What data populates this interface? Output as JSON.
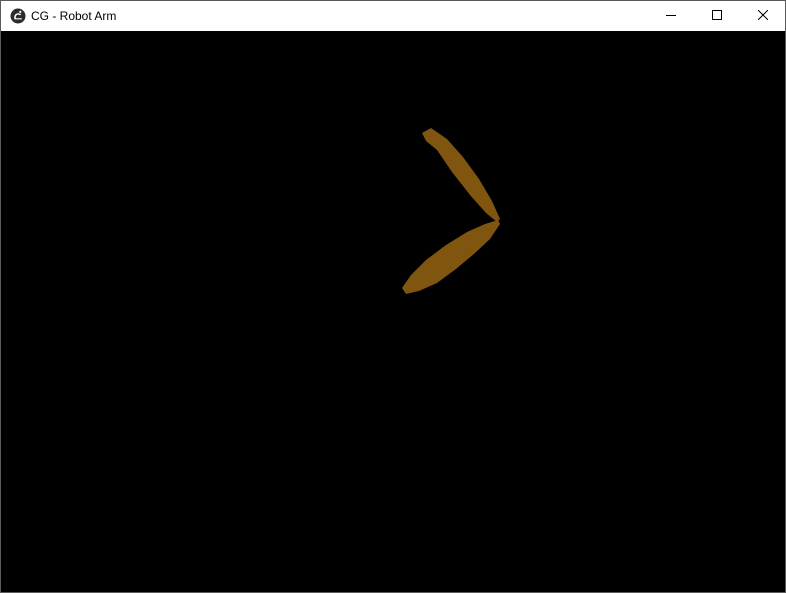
{
  "window": {
    "title": "CG - Robot Arm",
    "app_icon": "app-logo-icon"
  },
  "caption_buttons": {
    "minimize_icon": "minimize-icon",
    "maximize_icon": "maximize-icon",
    "close_icon": "close-icon"
  },
  "scene": {
    "background_color": "#000000",
    "arm_color": "#7f5510",
    "segments": [
      "upper-arm-segment",
      "lower-arm-segment"
    ]
  }
}
